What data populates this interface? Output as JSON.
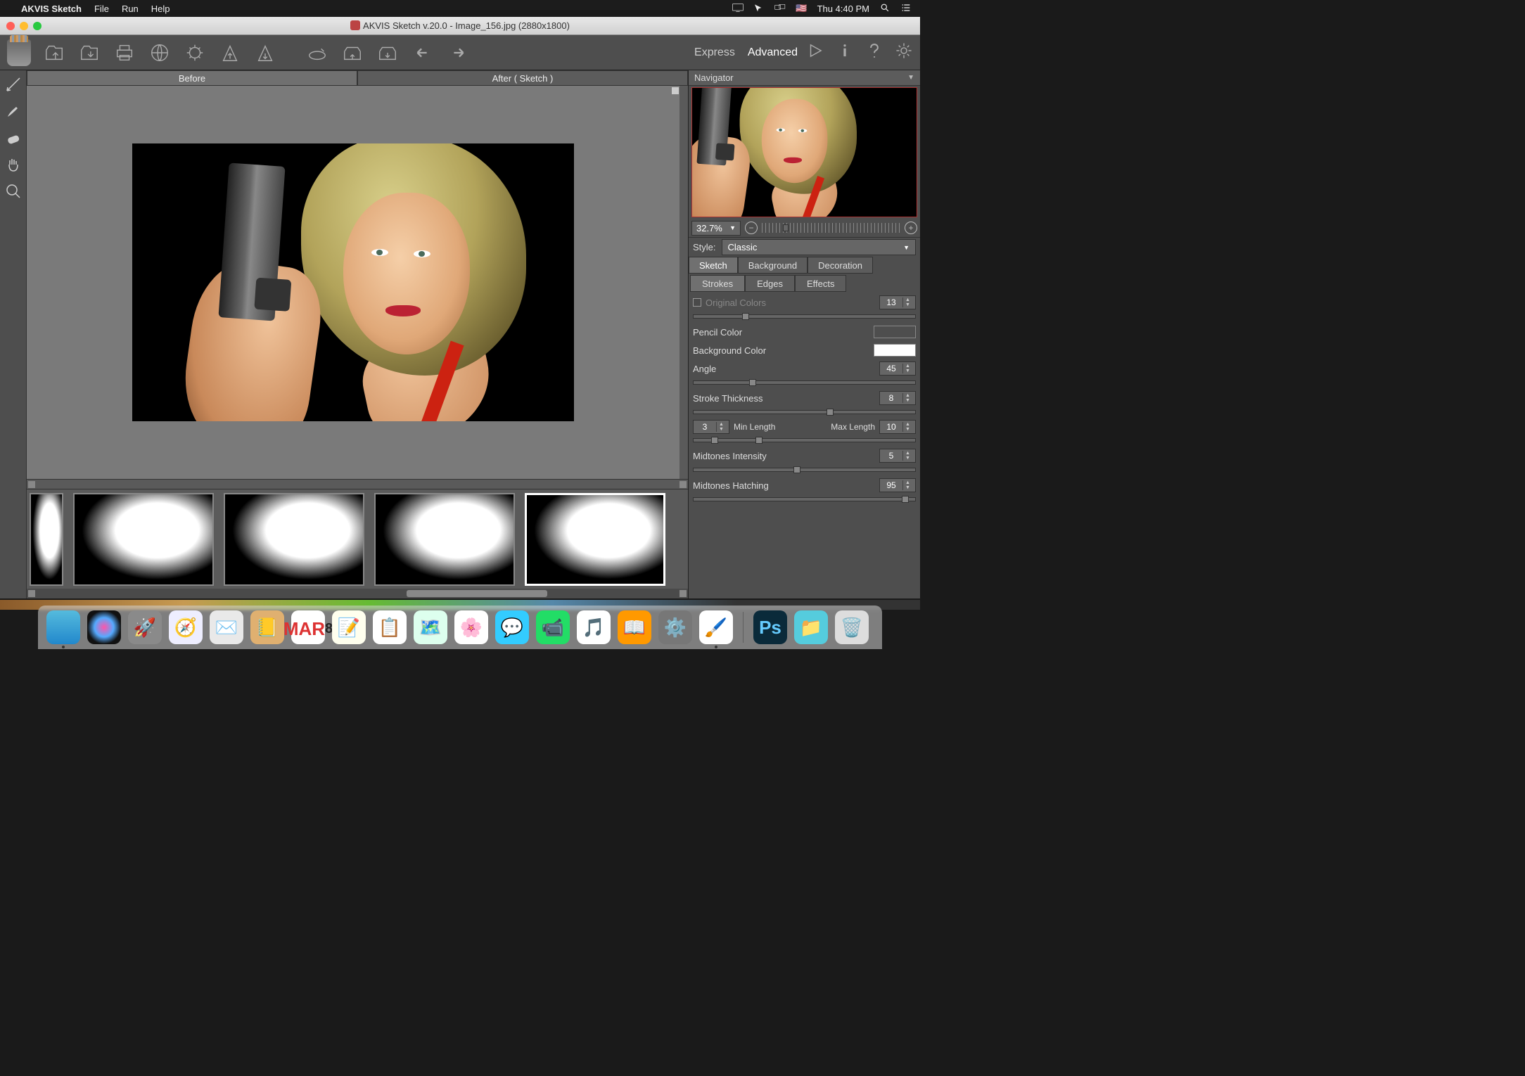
{
  "menubar": {
    "app_name": "AKVIS Sketch",
    "items": [
      "File",
      "Run",
      "Help"
    ],
    "flag": "🇺🇸",
    "datetime": "Thu 4:40 PM"
  },
  "window": {
    "title": "AKVIS Sketch v.20.0 - Image_156.jpg (2880x1800)"
  },
  "modes": {
    "express": "Express",
    "advanced": "Advanced"
  },
  "view_tabs": {
    "before": "Before",
    "after": "After ( Sketch )"
  },
  "navigator": {
    "title": "Navigator",
    "zoom": "32.7%"
  },
  "style": {
    "label": "Style:",
    "value": "Classic"
  },
  "panel_tabs": {
    "sketch": "Sketch",
    "background": "Background",
    "decoration": "Decoration"
  },
  "sub_tabs": {
    "strokes": "Strokes",
    "edges": "Edges",
    "effects": "Effects"
  },
  "params": {
    "original_colors": {
      "label": "Original Colors",
      "value": "13"
    },
    "pencil_color": {
      "label": "Pencil Color",
      "hex": "#000000"
    },
    "background_color": {
      "label": "Background Color",
      "hex": "#ffffff"
    },
    "angle": {
      "label": "Angle",
      "value": "45"
    },
    "stroke_thickness": {
      "label": "Stroke Thickness",
      "value": "8"
    },
    "min_length": {
      "label": "Min Length",
      "value": "3"
    },
    "max_length": {
      "label": "Max Length",
      "value": "10"
    },
    "midtones_intensity": {
      "label": "Midtones Intensity",
      "value": "5"
    },
    "midtones_hatching": {
      "label": "Midtones Hatching",
      "value": "95"
    }
  },
  "dock": {
    "cal_month": "MAR",
    "cal_day": "8",
    "ps": "Ps"
  }
}
